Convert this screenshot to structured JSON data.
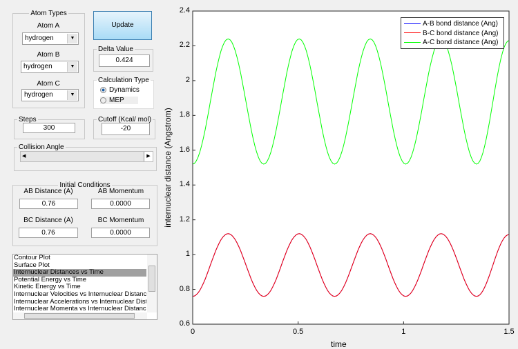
{
  "atom_types": {
    "title": "Atom Types",
    "atom_a_label": "Atom A",
    "atom_a": "hydrogen",
    "atom_b_label": "Atom B",
    "atom_b": "hydrogen",
    "atom_c_label": "Atom C",
    "atom_c": "hydrogen"
  },
  "update_label": "Update",
  "delta": {
    "label": "Delta Value",
    "value": "0.424"
  },
  "calc": {
    "label": "Calculation Type",
    "options": [
      "Dynamics",
      "MEP"
    ],
    "selected": "Dynamics"
  },
  "steps": {
    "label": "Steps",
    "value": "300"
  },
  "cutoff": {
    "label": "Cutoff (Kcal/ mol)",
    "value": "-20"
  },
  "collision": {
    "label": "Collision Angle",
    "slider_fraction": 1.0
  },
  "initial": {
    "title": "Initial Conditions",
    "ab_dist_label": "AB Distance (A)",
    "ab_dist": "0.76",
    "ab_mom_label": "AB Momentum",
    "ab_mom": "0.0000",
    "bc_dist_label": "BC Distance (A)",
    "bc_dist": "0.76",
    "bc_mom_label": "BC Momentum",
    "bc_mom": "0.0000"
  },
  "plot_list": {
    "items": [
      "Contour Plot",
      "Surface Plot",
      "Internuclear Distances vs Time",
      "Potential Energy vs Time",
      "Kinetic Energy vs Time",
      "Internuclear Velocities vs Internuclear Distance",
      "Internuclear Accelerations vs Internuclear Distance",
      "Internuclear Momenta vs Internuclear Distance"
    ],
    "selected": "Internuclear Distances vs Time"
  },
  "chart_data": {
    "type": "line",
    "xlabel": "time",
    "ylabel": "internuclear distance (Angstrom)",
    "xlim": [
      0,
      1.5
    ],
    "ylim": [
      0.6,
      2.4
    ],
    "xticks": [
      "0",
      "0.5",
      "1",
      "1.5"
    ],
    "yticks": [
      "0.6",
      "0.8",
      "1",
      "1.2",
      "1.4",
      "1.6",
      "1.8",
      "2",
      "2.2",
      "2.4"
    ],
    "legend": "top-right",
    "grid": false,
    "x": [
      0,
      0.168,
      0.337,
      0.505,
      0.673,
      0.842,
      1.01,
      1.178,
      1.346,
      1.5
    ],
    "series": [
      {
        "name": "A-B bond distance (Ang)",
        "color": "#0000ff",
        "values": [
          0.76,
          1.12,
          0.76,
          1.12,
          0.76,
          1.12,
          0.76,
          1.12,
          0.76,
          1.115
        ]
      },
      {
        "name": "B-C bond distance (Ang)",
        "color": "#ff0000",
        "values": [
          0.76,
          1.12,
          0.76,
          1.12,
          0.76,
          1.12,
          0.76,
          1.12,
          0.76,
          1.115
        ]
      },
      {
        "name": "A-C bond distance (Ang)",
        "color": "#00ff00",
        "values": [
          1.52,
          2.24,
          1.52,
          2.24,
          1.52,
          2.24,
          1.52,
          2.24,
          1.52,
          2.23
        ]
      }
    ]
  }
}
